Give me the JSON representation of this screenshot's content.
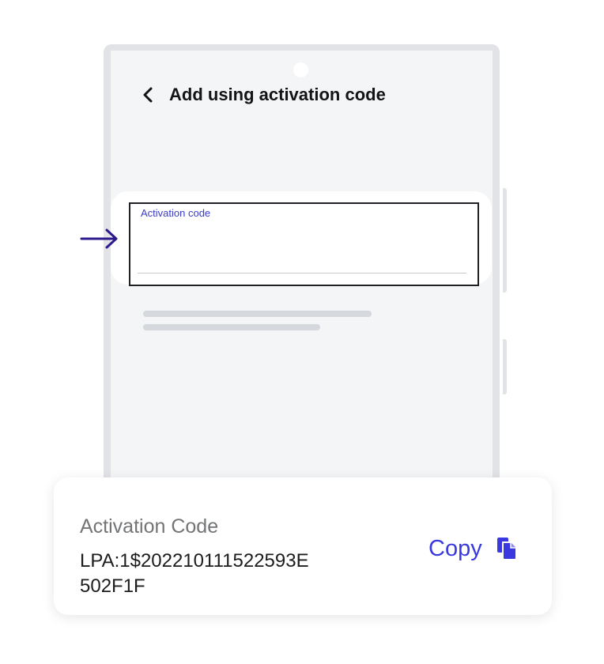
{
  "screen": {
    "title": "Add using activation code"
  },
  "field": {
    "label": "Activation code"
  },
  "card": {
    "label": "Activation Code",
    "code_line1": "LPA:1$202210111522593E",
    "code_line2": "502F1F",
    "copy_label": "Copy"
  },
  "colors": {
    "accent": "#3a39e0",
    "arrow": "#2e1a8c",
    "screen_bg": "#f4f5f7",
    "phone_frame": "#e2e3e6"
  },
  "icons": {
    "back": "chevron-left-icon",
    "copy": "copy-icon",
    "pointer": "arrow-right-icon"
  }
}
